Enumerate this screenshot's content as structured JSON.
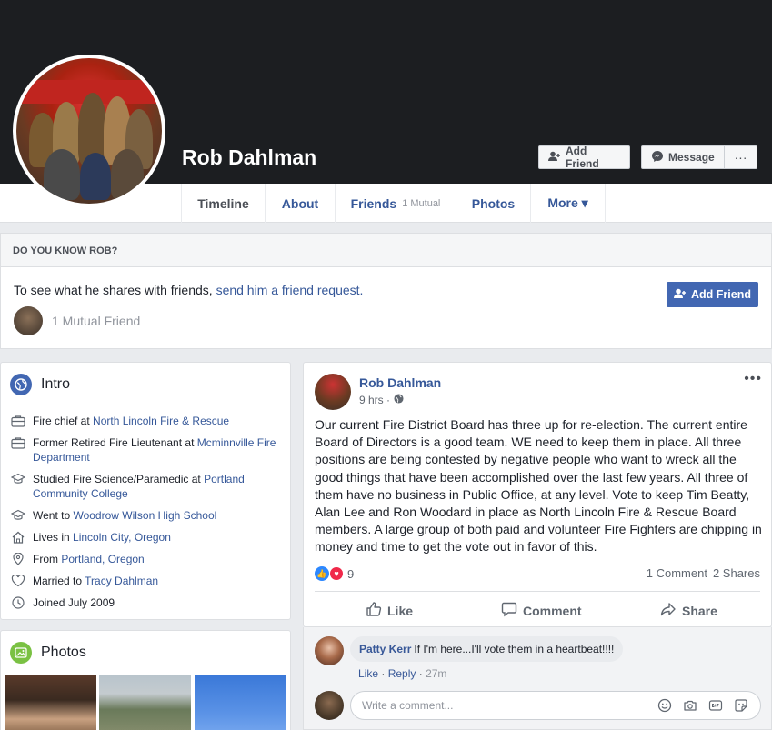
{
  "profile": {
    "name": "Rob Dahlman",
    "add_friend_label": "Add Friend",
    "message_label": "Message",
    "more_label": "···"
  },
  "tabs": [
    {
      "label": "Timeline"
    },
    {
      "label": "About"
    },
    {
      "label": "Friends",
      "sub": "1 Mutual"
    },
    {
      "label": "Photos"
    },
    {
      "label": "More ▾"
    }
  ],
  "know_box": {
    "heading": "DO YOU KNOW ROB?",
    "text": "To see what he shares with friends,",
    "link": "send him a friend request.",
    "button": "Add Friend",
    "mutual": "1 Mutual Friend"
  },
  "intro": {
    "title": "Intro",
    "items": [
      {
        "prefix": "Fire chief at ",
        "link": "North Lincoln Fire & Rescue"
      },
      {
        "prefix": "Former Retired Fire Lieutenant at ",
        "link": "Mcminnville Fire Department"
      },
      {
        "prefix": "Studied Fire Science/Paramedic at ",
        "link": "Portland Community College"
      },
      {
        "prefix": "Went to ",
        "link": "Woodrow Wilson High School"
      },
      {
        "prefix": "Lives in ",
        "link": "Lincoln City, Oregon"
      },
      {
        "prefix": "From ",
        "link": "Portland, Oregon"
      },
      {
        "prefix": "Married to ",
        "link": "Tracy Dahlman"
      },
      {
        "prefix": "Joined July 2009",
        "link": ""
      }
    ]
  },
  "photos": {
    "title": "Photos"
  },
  "post": {
    "author": "Rob Dahlman",
    "time": "9 hrs ·",
    "text": "Our current Fire District Board has three up for re-election. The current entire Board of Directors is a good team. WE need to keep them in place. All three positions are being contested by negative people who want to wreck all the good things that have been accomplished over the last few years. All three of them have no business in Public Office, at any level. Vote to keep Tim Beatty, Alan Lee and Ron Woodard in place as North Lincoln Fire & Rescue Board members. A large group of both paid and volunteer Fire Fighters are chipping in money and time to get the vote out in favor of this.",
    "reactions_count": "9",
    "comments_count": "1 Comment",
    "shares_count": "2 Shares",
    "like_label": "Like",
    "comment_label": "Comment",
    "share_label": "Share"
  },
  "comment": {
    "author": "Patty Kerr",
    "text": "If I'm here...I'll vote them in a heartbeat!!!!",
    "like": "Like",
    "reply": "Reply",
    "sep": "·",
    "time": "27m",
    "input_placeholder": "Write a comment..."
  },
  "colors": {
    "brand_blue": "#4267b2",
    "link_blue": "#365899",
    "cover_dark": "#1c1e21",
    "page_bg": "#e9ebee"
  }
}
